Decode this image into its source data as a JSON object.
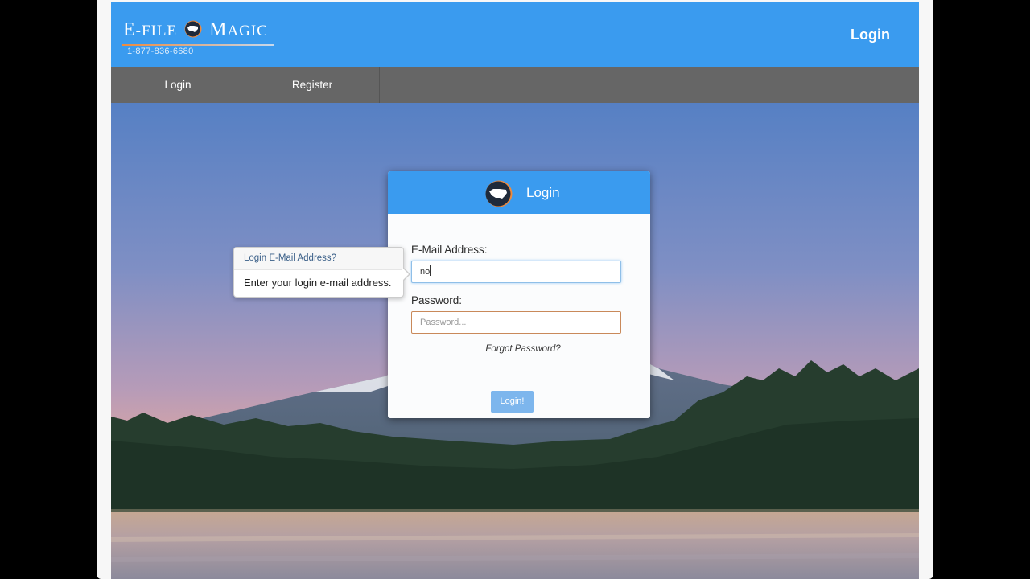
{
  "brand": {
    "logo_e": "E",
    "logo_file": "-FILE",
    "logo_magic_m": "M",
    "logo_magic_rest": "AGIC",
    "phone": "1-877-836-6680"
  },
  "header": {
    "login_link": "Login"
  },
  "nav": {
    "items": [
      {
        "label": "Login"
      },
      {
        "label": "Register"
      }
    ]
  },
  "login_panel": {
    "title": "Login",
    "email_label": "E-Mail Address:",
    "email_value": "no",
    "password_label": "Password:",
    "password_placeholder": "Password...",
    "forgot_link": "Forgot Password?",
    "submit_label": "Login!"
  },
  "tooltip": {
    "title": "Login E-Mail Address?",
    "body": "Enter your login e-mail address."
  },
  "colors": {
    "brand_blue": "#3a9bef",
    "nav_gray": "#666666",
    "button_blue": "#7db6ed",
    "accent_orange": "#f08a3c"
  },
  "icons": {
    "logo_globe": "usa-globe-icon"
  }
}
